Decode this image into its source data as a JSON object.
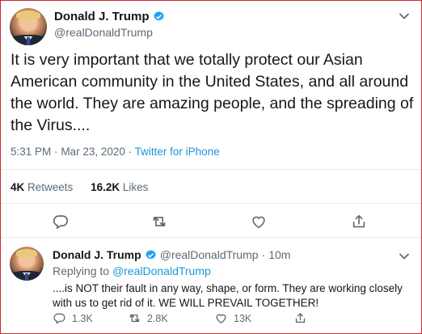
{
  "main_tweet": {
    "author_name": "Donald J. Trump",
    "author_handle": "@realDonaldTrump",
    "text": "It is very important that we totally protect our Asian American community in the United States, and all around the world. They are amazing people, and the spreading of the Virus....",
    "time": "5:31 PM",
    "separator": "·",
    "date": "Mar 23, 2020",
    "source": "Twitter for iPhone",
    "retweets_count": "4K",
    "retweets_label": "Retweets",
    "likes_count": "16.2K",
    "likes_label": "Likes"
  },
  "reply_tweet": {
    "author_name": "Donald J. Trump",
    "author_handle": "@realDonaldTrump",
    "age": "10m",
    "separator": "·",
    "replying_prefix": "Replying to",
    "replying_handle": "@realDonaldTrump",
    "text": "....is NOT their fault in any way, shape, or form. They are working closely with us to get rid of it. WE WILL PREVAIL TOGETHER!",
    "reply_count": "1.3K",
    "retweet_count": "2.8K",
    "like_count": "13K"
  },
  "icons": {
    "verified": "verified-badge-icon",
    "more": "chevron-down-icon",
    "reply": "reply-icon",
    "retweet": "retweet-icon",
    "like": "heart-icon",
    "share": "share-icon"
  },
  "colors": {
    "link": "#1b95e0",
    "muted": "#5b6b78",
    "text": "#14171a",
    "frame": "#c9262c"
  }
}
